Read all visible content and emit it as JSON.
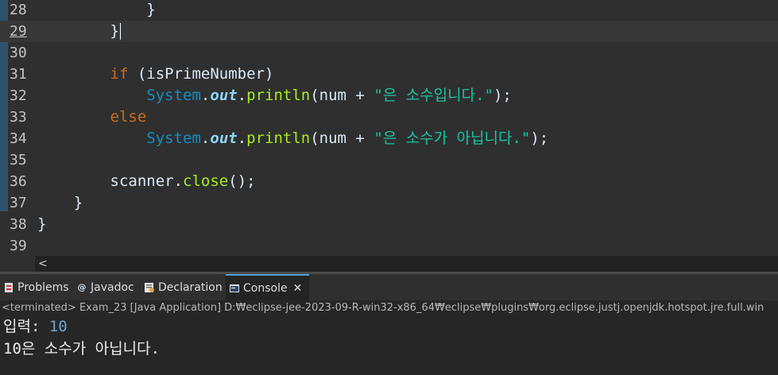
{
  "editor": {
    "lines": [
      {
        "num": "28",
        "indent": "            ",
        "tokens": [
          {
            "t": "}",
            "c": "plain"
          }
        ]
      },
      {
        "num": "29",
        "indent": "        ",
        "tokens": [
          {
            "t": "}",
            "c": "plain"
          }
        ],
        "current": true
      },
      {
        "num": "30",
        "indent": "",
        "tokens": []
      },
      {
        "num": "31",
        "indent": "        ",
        "tokens": [
          {
            "t": "if",
            "c": "kw"
          },
          {
            "t": " (isPrimeNumber)",
            "c": "plain"
          }
        ]
      },
      {
        "num": "32",
        "indent": "            ",
        "tokens": [
          {
            "t": "System",
            "c": "cls"
          },
          {
            "t": ".",
            "c": "plain"
          },
          {
            "t": "out",
            "c": "fld"
          },
          {
            "t": ".",
            "c": "plain"
          },
          {
            "t": "println",
            "c": "mth"
          },
          {
            "t": "(num + ",
            "c": "plain"
          },
          {
            "t": "\"은 소수입니다.\"",
            "c": "str"
          },
          {
            "t": ");",
            "c": "plain"
          }
        ]
      },
      {
        "num": "33",
        "indent": "        ",
        "tokens": [
          {
            "t": "else",
            "c": "kw"
          }
        ]
      },
      {
        "num": "34",
        "indent": "            ",
        "tokens": [
          {
            "t": "System",
            "c": "cls"
          },
          {
            "t": ".",
            "c": "plain"
          },
          {
            "t": "out",
            "c": "fld"
          },
          {
            "t": ".",
            "c": "plain"
          },
          {
            "t": "println",
            "c": "mth"
          },
          {
            "t": "(num + ",
            "c": "plain"
          },
          {
            "t": "\"은 소수가 아닙니다.\"",
            "c": "str"
          },
          {
            "t": ");",
            "c": "plain"
          }
        ]
      },
      {
        "num": "35",
        "indent": "",
        "tokens": []
      },
      {
        "num": "36",
        "indent": "        ",
        "tokens": [
          {
            "t": "scanner",
            "c": "plain"
          },
          {
            "t": ".",
            "c": "plain"
          },
          {
            "t": "close",
            "c": "mth"
          },
          {
            "t": "();",
            "c": "plain"
          }
        ]
      },
      {
        "num": "37",
        "indent": "    ",
        "tokens": [
          {
            "t": "}",
            "c": "plain"
          }
        ]
      },
      {
        "num": "38",
        "indent": "",
        "tokens": [
          {
            "t": "}",
            "c": "plain"
          }
        ]
      },
      {
        "num": "39",
        "indent": "",
        "tokens": []
      }
    ]
  },
  "scrollbar": {
    "left_arrow": "<"
  },
  "tabs": [
    {
      "label": "Problems",
      "icon": "problems-icon",
      "active": false
    },
    {
      "label": "Javadoc",
      "icon": "javadoc-icon",
      "active": false
    },
    {
      "label": "Declaration",
      "icon": "declaration-icon",
      "active": false
    },
    {
      "label": "Console",
      "icon": "console-icon",
      "active": true,
      "close": "✕"
    }
  ],
  "console": {
    "status": "<terminated> Exam_23 [Java Application] D:₩eclipse-jee-2023-09-R-win32-x86_64₩eclipse₩plugins₩org.eclipse.justj.openjdk.hotspot.jre.full.win",
    "prompt": "입력: ",
    "input_value": "10",
    "output": "10은 소수가 아닙니다."
  },
  "colors": {
    "keyword": "#cc6c1d",
    "class": "#1290c3",
    "field": "#8dd4f0",
    "method": "#a7ec21",
    "string": "#17c6a3",
    "active_tab_accent": "#4f9fcf"
  }
}
